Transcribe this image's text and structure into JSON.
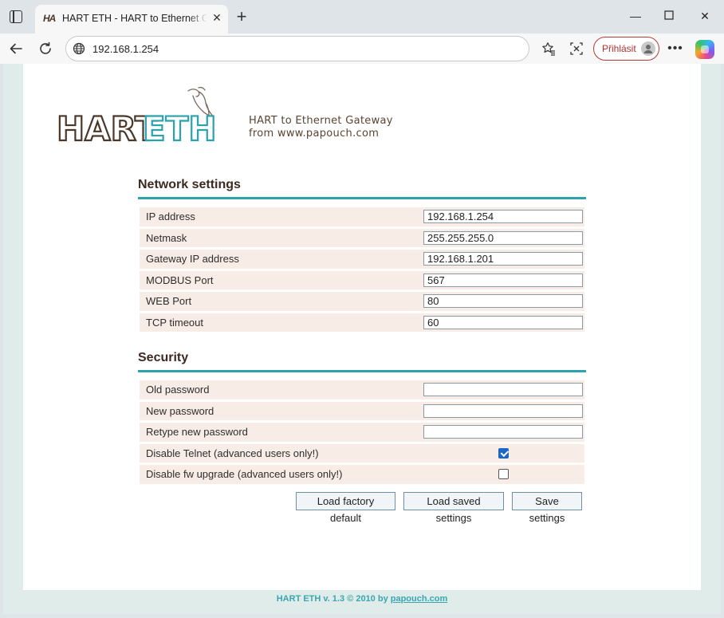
{
  "browser": {
    "tab": {
      "favicon_text": "HA",
      "title": "HART ETH - HART to Ethernet Gateway"
    },
    "url": "192.168.1.254",
    "login_label": "Přihlásit"
  },
  "page": {
    "logo": {
      "word1": "HART",
      "word2": "ETH",
      "colors": {
        "hart": "#4a3728",
        "eth": "#2aa3ad"
      }
    },
    "tagline": {
      "line1": "HART to Ethernet Gateway",
      "line2": "from www.papouch.com"
    },
    "network": {
      "title": "Network settings",
      "rows": [
        {
          "label": "IP address",
          "value": "192.168.1.254"
        },
        {
          "label": "Netmask",
          "value": "255.255.255.0"
        },
        {
          "label": "Gateway IP address",
          "value": "192.168.1.201"
        },
        {
          "label": "MODBUS Port",
          "value": "567"
        },
        {
          "label": "WEB Port",
          "value": "80"
        },
        {
          "label": "TCP timeout",
          "value": "60"
        }
      ]
    },
    "security": {
      "title": "Security",
      "rows": [
        {
          "label": "Old password",
          "value": ""
        },
        {
          "label": "New password",
          "value": ""
        },
        {
          "label": "Retype new password",
          "value": ""
        },
        {
          "label": "Disable Telnet (advanced users only!)",
          "checked": true
        },
        {
          "label": "Disable fw upgrade (advanced users only!)",
          "checked": false
        }
      ]
    },
    "buttons": {
      "factory": "Load factory default",
      "saved": "Load saved settings",
      "save": "Save settings"
    },
    "footer": {
      "text": "HART ETH v. 1.3 © 2010 by ",
      "link": "papouch.com"
    }
  }
}
